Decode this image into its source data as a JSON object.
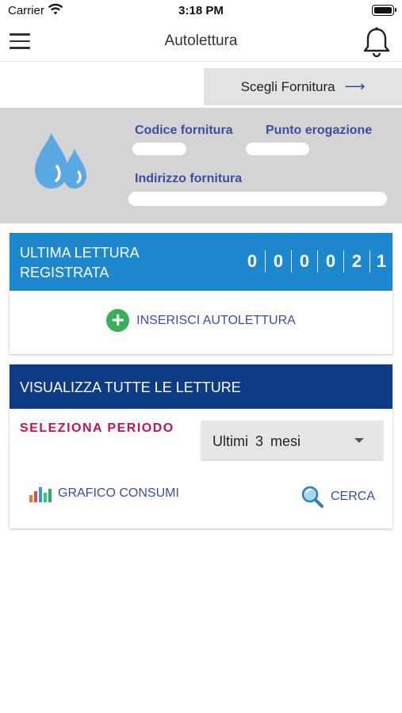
{
  "status_bar": {
    "carrier": "Carrier",
    "time": "3:18 PM"
  },
  "nav": {
    "title": "Autolettura"
  },
  "supply_selector": {
    "label": "Scegli Fornitura",
    "arrow": "⟶"
  },
  "supply_info": {
    "code_label": "Codice fornitura",
    "delivery_point_label": "Punto erogazione",
    "address_label": "Indirizzo fornitura"
  },
  "last_reading": {
    "title": "ULTIMA LETTURA REGISTRATA",
    "digits": [
      "0",
      "0",
      "0",
      "0",
      "2",
      "1"
    ],
    "insert_label": "INSERISCI AUTOLETTURA"
  },
  "all_readings": {
    "title": "VISUALIZZA TUTTE LE LETTURE",
    "period_label": "SELEZIONA PERIODO",
    "period_value": "Ultimi 3 mesi",
    "graph_label": "GRAFICO CONSUMI",
    "search_label": "CERCA"
  },
  "colors": {
    "accent_blue": "#1e88cf",
    "dark_blue": "#0d3b84",
    "link_blue": "#3b4ea3",
    "crimson": "#c3134c",
    "green": "#38b05a"
  },
  "icons": [
    "wifi-icon",
    "battery-icon",
    "menu-icon",
    "bell-icon",
    "arrow-right-icon",
    "water-drops-icon",
    "plus-circle-icon",
    "bar-chart-icon",
    "magnifier-icon",
    "caret-down-icon"
  ]
}
